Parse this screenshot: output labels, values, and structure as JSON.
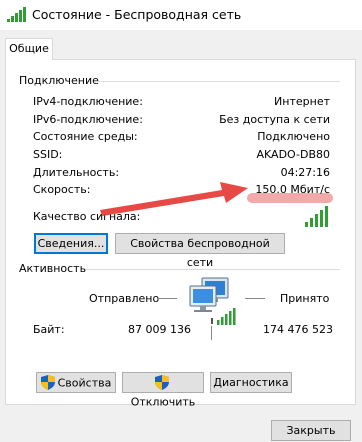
{
  "window": {
    "title": "Состояние - Беспроводная сеть"
  },
  "tabs": [
    {
      "label": "Общие"
    }
  ],
  "connection": {
    "section_label": "Подключение",
    "rows": [
      {
        "label": "IPv4-подключение:",
        "value": "Интернет"
      },
      {
        "label": "IPv6-подключение:",
        "value": "Без доступа к сети"
      },
      {
        "label": "Состояние среды:",
        "value": "Подключено"
      },
      {
        "label": "SSID:",
        "value": "AKADO-DB80"
      },
      {
        "label": "Длительность:",
        "value": "04:27:16"
      },
      {
        "label": "Скорость:",
        "value": "150.0 Мбит/с"
      }
    ],
    "signal_label": "Качество сигнала:",
    "signal_level": "5 of 5 bars",
    "details_button": "Сведения...",
    "wireless_props_button": "Свойства беспроводной сети"
  },
  "activity": {
    "section_label": "Активность",
    "sent_label": "Отправлено",
    "received_label": "Принято",
    "bytes_label": "Байт:",
    "sent_bytes": "87 009 136",
    "received_bytes": "174 476 523"
  },
  "actions": {
    "properties_button": "Свойства",
    "disconnect_button": "Отключить",
    "diagnostics_button": "Диагностика"
  },
  "footer": {
    "close_button": "Закрыть"
  },
  "colors": {
    "signal_green": "#2e9e35",
    "annotation_red": "#e53935",
    "focus_blue": "#0078d7"
  },
  "icons": [
    "wireless-signal-icon",
    "network-computers-icon",
    "uac-shield-icon"
  ]
}
